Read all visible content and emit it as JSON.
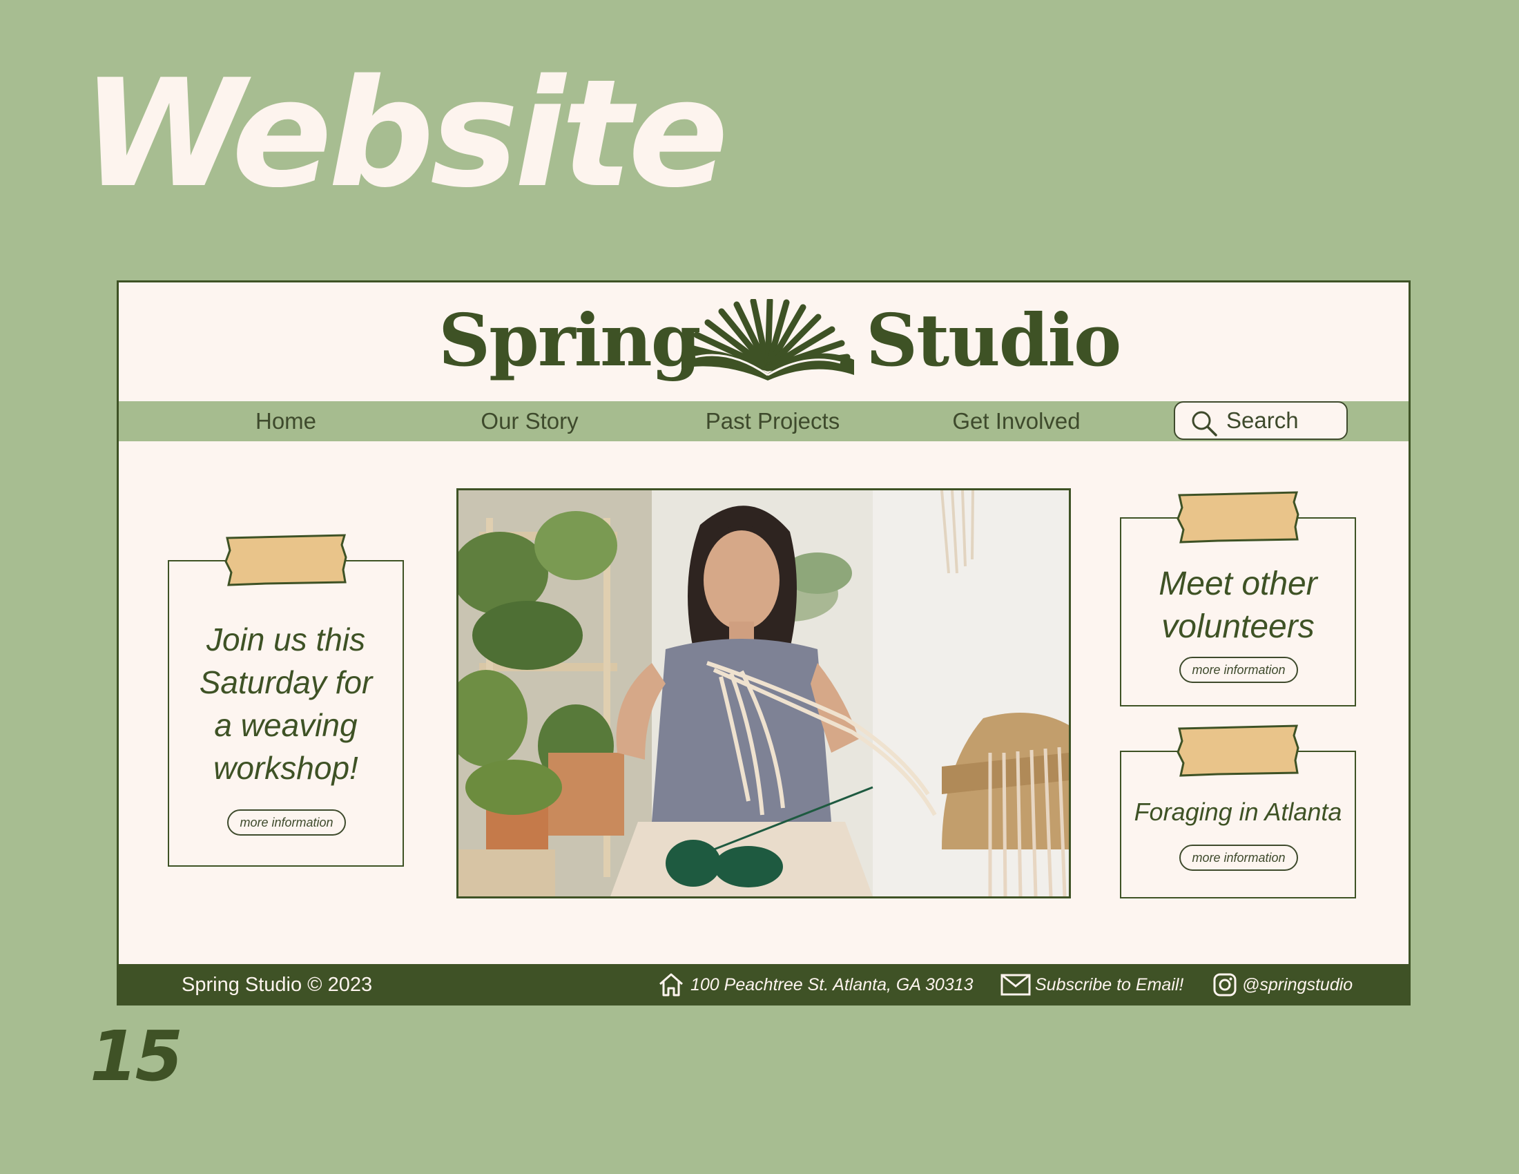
{
  "page": {
    "heading": "Website",
    "number": "15"
  },
  "brand": {
    "name_left": "Spring",
    "name_right": "Studio",
    "logo_icon": "fan-leaf-icon"
  },
  "nav": {
    "items": [
      "Home",
      "Our Story",
      "Past Projects",
      "Get Involved"
    ],
    "search_placeholder": "Search"
  },
  "cards": {
    "left": {
      "title_lines": [
        "Join us this",
        "Saturday for",
        "a weaving",
        "workshop!"
      ],
      "button": "more information"
    },
    "right_top": {
      "title_lines": [
        "Meet other",
        "volunteers"
      ],
      "button": "more information"
    },
    "right_bottom": {
      "title": "Foraging in Atlanta",
      "button": "more information"
    }
  },
  "footer": {
    "copyright": "Spring Studio © 2023",
    "address": "100 Peachtree St.  Atlanta, GA  30313",
    "subscribe": "Subscribe to Email!",
    "instagram": "@springstudio"
  },
  "colors": {
    "background": "#a7bd91",
    "dark_green": "#3e5225",
    "cream": "#fdf5f0",
    "tape": "#e9c48a"
  }
}
